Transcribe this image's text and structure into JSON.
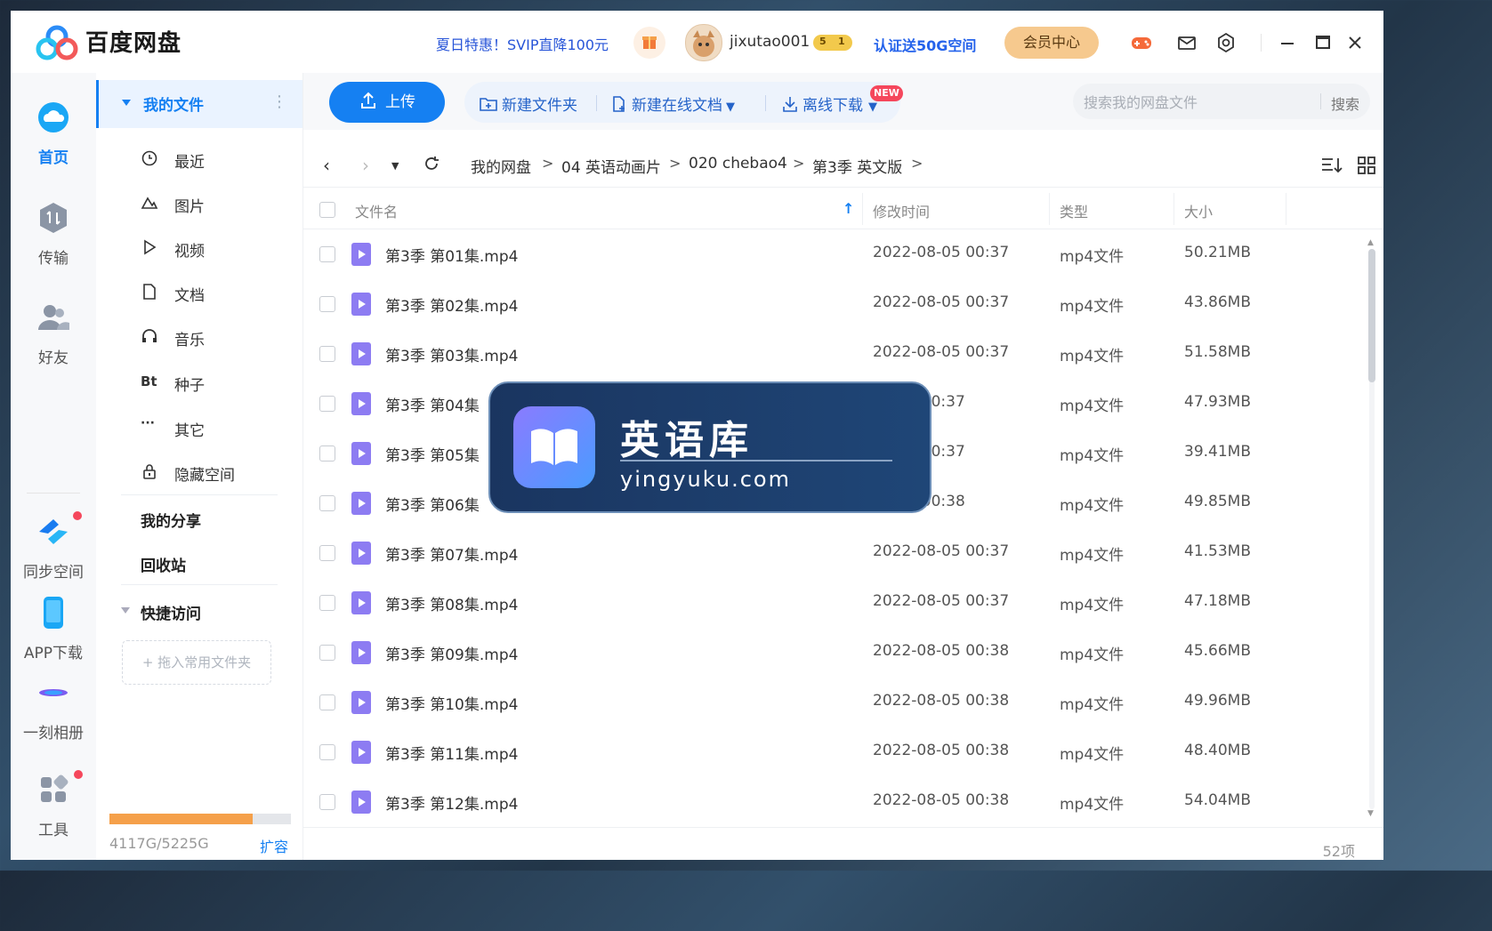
{
  "titlebar": {
    "app_title": "百度网盘",
    "promo": "夏日特惠！SVIP直降100元",
    "username": "jixutao001",
    "vip_level": "5",
    "vip_sub": "1",
    "cert": "认证送50G空间",
    "member_center": "会员中心"
  },
  "leftnav": {
    "items": [
      {
        "label": "首页"
      },
      {
        "label": "传输"
      },
      {
        "label": "好友"
      },
      {
        "label": "同步空间"
      },
      {
        "label": "APP下载"
      },
      {
        "label": "一刻相册"
      },
      {
        "label": "工具"
      }
    ]
  },
  "sidebar": {
    "my_files": "我的文件",
    "items": [
      {
        "label": "最近",
        "icon": "clock-icon"
      },
      {
        "label": "图片",
        "icon": "image-icon"
      },
      {
        "label": "视频",
        "icon": "play-icon"
      },
      {
        "label": "文档",
        "icon": "document-icon"
      },
      {
        "label": "音乐",
        "icon": "headphones-icon"
      },
      {
        "label": "种子",
        "icon": "bt-icon",
        "glyph": "Bt"
      },
      {
        "label": "其它",
        "icon": "more-icon",
        "glyph": "···"
      },
      {
        "label": "隐藏空间",
        "icon": "lock-icon"
      }
    ],
    "my_share": "我的分享",
    "recycle": "回收站",
    "quick_access": "快捷访问",
    "drop_hint": "+ 拖入常用文件夹",
    "storage_text": "4117G/5225G",
    "storage_used_fraction": 0.788,
    "expand": "扩容"
  },
  "toolbar": {
    "upload": "上传",
    "new_folder": "新建文件夹",
    "new_online_doc": "新建在线文档",
    "new_badge": "NEW",
    "offline_download": "离线下载",
    "search_placeholder": "搜索我的网盘文件",
    "search_button": "搜索"
  },
  "breadcrumb": {
    "items": [
      "我的网盘",
      "04 英语动画片",
      "020 chebao4",
      "第3季 英文版"
    ],
    "sep": ">"
  },
  "table": {
    "headers": {
      "name": "文件名",
      "modified": "修改时间",
      "type": "类型",
      "size": "大小"
    },
    "rows": [
      {
        "name": "第3季 第01集.mp4",
        "date": "2022-08-05 00:37",
        "type": "mp4文件",
        "size": "50.21MB"
      },
      {
        "name": "第3季 第02集.mp4",
        "date": "2022-08-05 00:37",
        "type": "mp4文件",
        "size": "43.86MB"
      },
      {
        "name": "第3季 第03集.mp4",
        "date": "2022-08-05 00:37",
        "type": "mp4文件",
        "size": "51.58MB"
      },
      {
        "name": "第3季 第04集",
        "date": "08-05 00:37",
        "type": "mp4文件",
        "size": "47.93MB"
      },
      {
        "name": "第3季 第05集",
        "date": "08-05 00:37",
        "type": "mp4文件",
        "size": "39.41MB"
      },
      {
        "name": "第3季 第06集",
        "date": "08-05 00:38",
        "type": "mp4文件",
        "size": "49.85MB"
      },
      {
        "name": "第3季 第07集.mp4",
        "date": "2022-08-05 00:37",
        "type": "mp4文件",
        "size": "41.53MB"
      },
      {
        "name": "第3季 第08集.mp4",
        "date": "2022-08-05 00:37",
        "type": "mp4文件",
        "size": "47.18MB"
      },
      {
        "name": "第3季 第09集.mp4",
        "date": "2022-08-05 00:38",
        "type": "mp4文件",
        "size": "45.66MB"
      },
      {
        "name": "第3季 第10集.mp4",
        "date": "2022-08-05 00:38",
        "type": "mp4文件",
        "size": "49.96MB"
      },
      {
        "name": "第3季 第11集.mp4",
        "date": "2022-08-05 00:38",
        "type": "mp4文件",
        "size": "48.40MB"
      },
      {
        "name": "第3季 第12集.mp4",
        "date": "2022-08-05 00:38",
        "type": "mp4文件",
        "size": "54.04MB"
      }
    ],
    "count": "52项"
  },
  "watermark": {
    "title": "英语库",
    "url": "yingyuku.com"
  },
  "colors": {
    "accent": "#1580f2",
    "file_icon": "#8d7cf2",
    "storage_fill": "#f5a04a",
    "vip_gold": "#f6c98e"
  }
}
